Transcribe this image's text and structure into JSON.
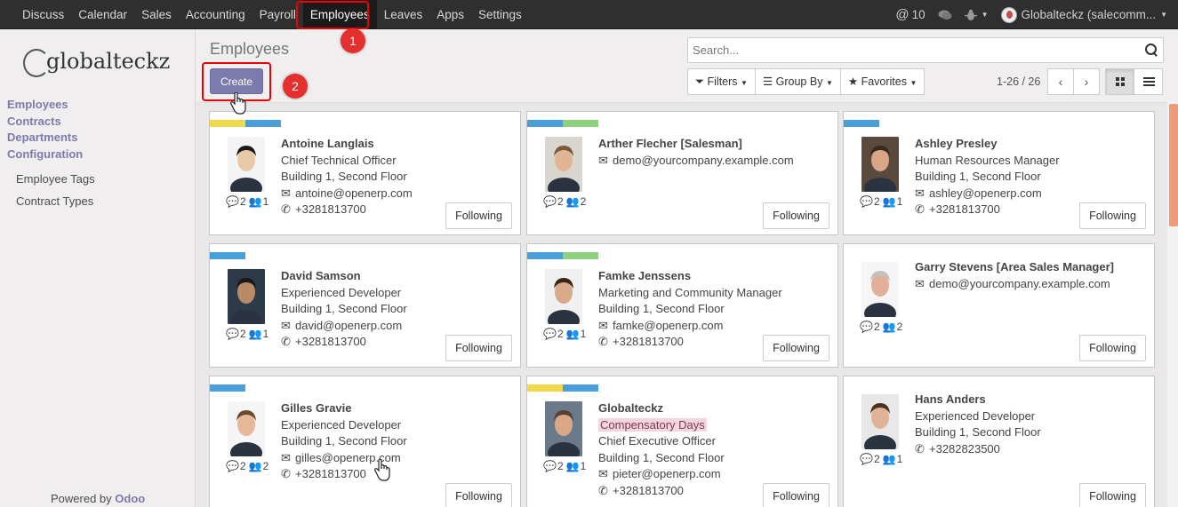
{
  "topbar": {
    "menu": [
      {
        "label": "Discuss",
        "name": "nav-discuss"
      },
      {
        "label": "Calendar",
        "name": "nav-calendar"
      },
      {
        "label": "Sales",
        "name": "nav-sales"
      },
      {
        "label": "Accounting",
        "name": "nav-accounting"
      },
      {
        "label": "Payroll",
        "name": "nav-payroll"
      },
      {
        "label": "Employees",
        "name": "nav-employees",
        "active": true
      },
      {
        "label": "Leaves",
        "name": "nav-leaves"
      },
      {
        "label": "Apps",
        "name": "nav-apps"
      },
      {
        "label": "Settings",
        "name": "nav-settings"
      }
    ],
    "mention_count": "10",
    "user": "Globalteckz (salecomm..."
  },
  "sidebar": {
    "logo_text": "globalteckz",
    "headers": [
      "Employees",
      "Contracts",
      "Departments",
      "Configuration"
    ],
    "subitems": [
      "Employee Tags",
      "Contract Types"
    ],
    "powered_prefix": "Powered by",
    "powered_brand": "Odoo"
  },
  "control": {
    "title": "Employees",
    "create_label": "Create",
    "search_placeholder": "Search...",
    "filters_label": "Filters",
    "groupby_label": "Group By",
    "favorites_label": "Favorites",
    "pager": "1-26 / 26"
  },
  "annotations": [
    "1",
    "2"
  ],
  "tag_colors": {
    "yellow": "#f2d94a",
    "blue": "#4a9ed9",
    "green": "#8dd17c"
  },
  "follow_label": "Following",
  "employees": [
    {
      "name": "Antoine Langlais",
      "lines": [
        "Chief Technical Officer",
        "Building 1, Second Floor"
      ],
      "email": "antoine@openerp.com",
      "phone": "+3281813700",
      "msgs": "2",
      "followers": "1",
      "tags": [
        "yellow",
        "blue"
      ]
    },
    {
      "name": "Arther Flecher [Salesman]",
      "lines": [],
      "email": "demo@yourcompany.example.com",
      "phone": "",
      "msgs": "2",
      "followers": "2",
      "tags": [
        "blue",
        "green"
      ]
    },
    {
      "name": "Ashley Presley",
      "lines": [
        "Human Resources Manager",
        "Building 1, Second Floor"
      ],
      "email": "ashley@openerp.com",
      "phone": "+3281813700",
      "msgs": "2",
      "followers": "1",
      "tags": [
        "blue"
      ]
    },
    {
      "name": "David Samson",
      "lines": [
        "Experienced Developer",
        "Building 1, Second Floor"
      ],
      "email": "david@openerp.com",
      "phone": "+3281813700",
      "msgs": "2",
      "followers": "1",
      "tags": [
        "blue"
      ]
    },
    {
      "name": "Famke Jenssens",
      "lines": [
        "Marketing and Community Manager",
        "Building 1, Second Floor"
      ],
      "email": "famke@openerp.com",
      "phone": "+3281813700",
      "msgs": "2",
      "followers": "1",
      "tags": [
        "blue",
        "green"
      ]
    },
    {
      "name": "Garry Stevens [Area Sales Manager]",
      "lines": [],
      "email": "demo@yourcompany.example.com",
      "phone": "",
      "msgs": "2",
      "followers": "2",
      "tags": []
    },
    {
      "name": "Gilles Gravie",
      "lines": [
        "Experienced Developer",
        "Building 1, Second Floor"
      ],
      "email": "gilles@openerp.com",
      "phone": "+3281813700",
      "msgs": "2",
      "followers": "2",
      "tags": [
        "blue"
      ]
    },
    {
      "name": "Globalteckz",
      "pill": "Compensatory Days",
      "lines": [
        "Chief Executive Officer",
        "Building 1, Second Floor"
      ],
      "email": "pieter@openerp.com",
      "phone": "+3281813700",
      "msgs": "2",
      "followers": "1",
      "tags": [
        "yellow",
        "blue"
      ]
    },
    {
      "name": "Hans Anders",
      "lines": [
        "Experienced Developer",
        "Building 1, Second Floor"
      ],
      "email": "",
      "phone": "+3282823500",
      "msgs": "2",
      "followers": "1",
      "tags": []
    }
  ]
}
